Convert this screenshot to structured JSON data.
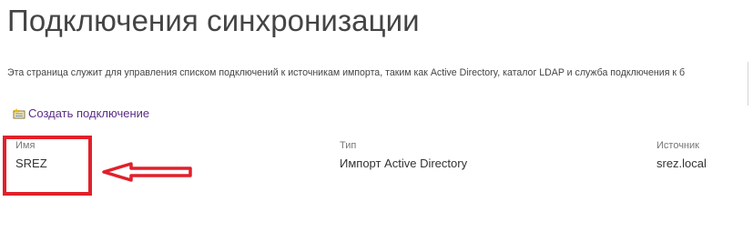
{
  "page": {
    "title": "Подключения синхронизации",
    "description": "Эта страница служит для управления списком подключений к источникам импорта, таким как Active Directory, каталог LDAP и служба подключения к б"
  },
  "toolbar": {
    "create_label": "Создать подключение",
    "create_icon": "new-item-icon"
  },
  "table": {
    "columns": [
      "Имя",
      "Тип",
      "Источник"
    ],
    "rows": [
      {
        "name": "SREZ",
        "type": "Импорт Active Directory",
        "source": "srez.local"
      }
    ]
  },
  "annotations": {
    "highlight_color": "#e1202a",
    "arrow_color": "#e1202a"
  },
  "colors": {
    "link": "#5b2e85",
    "title": "#444444"
  }
}
